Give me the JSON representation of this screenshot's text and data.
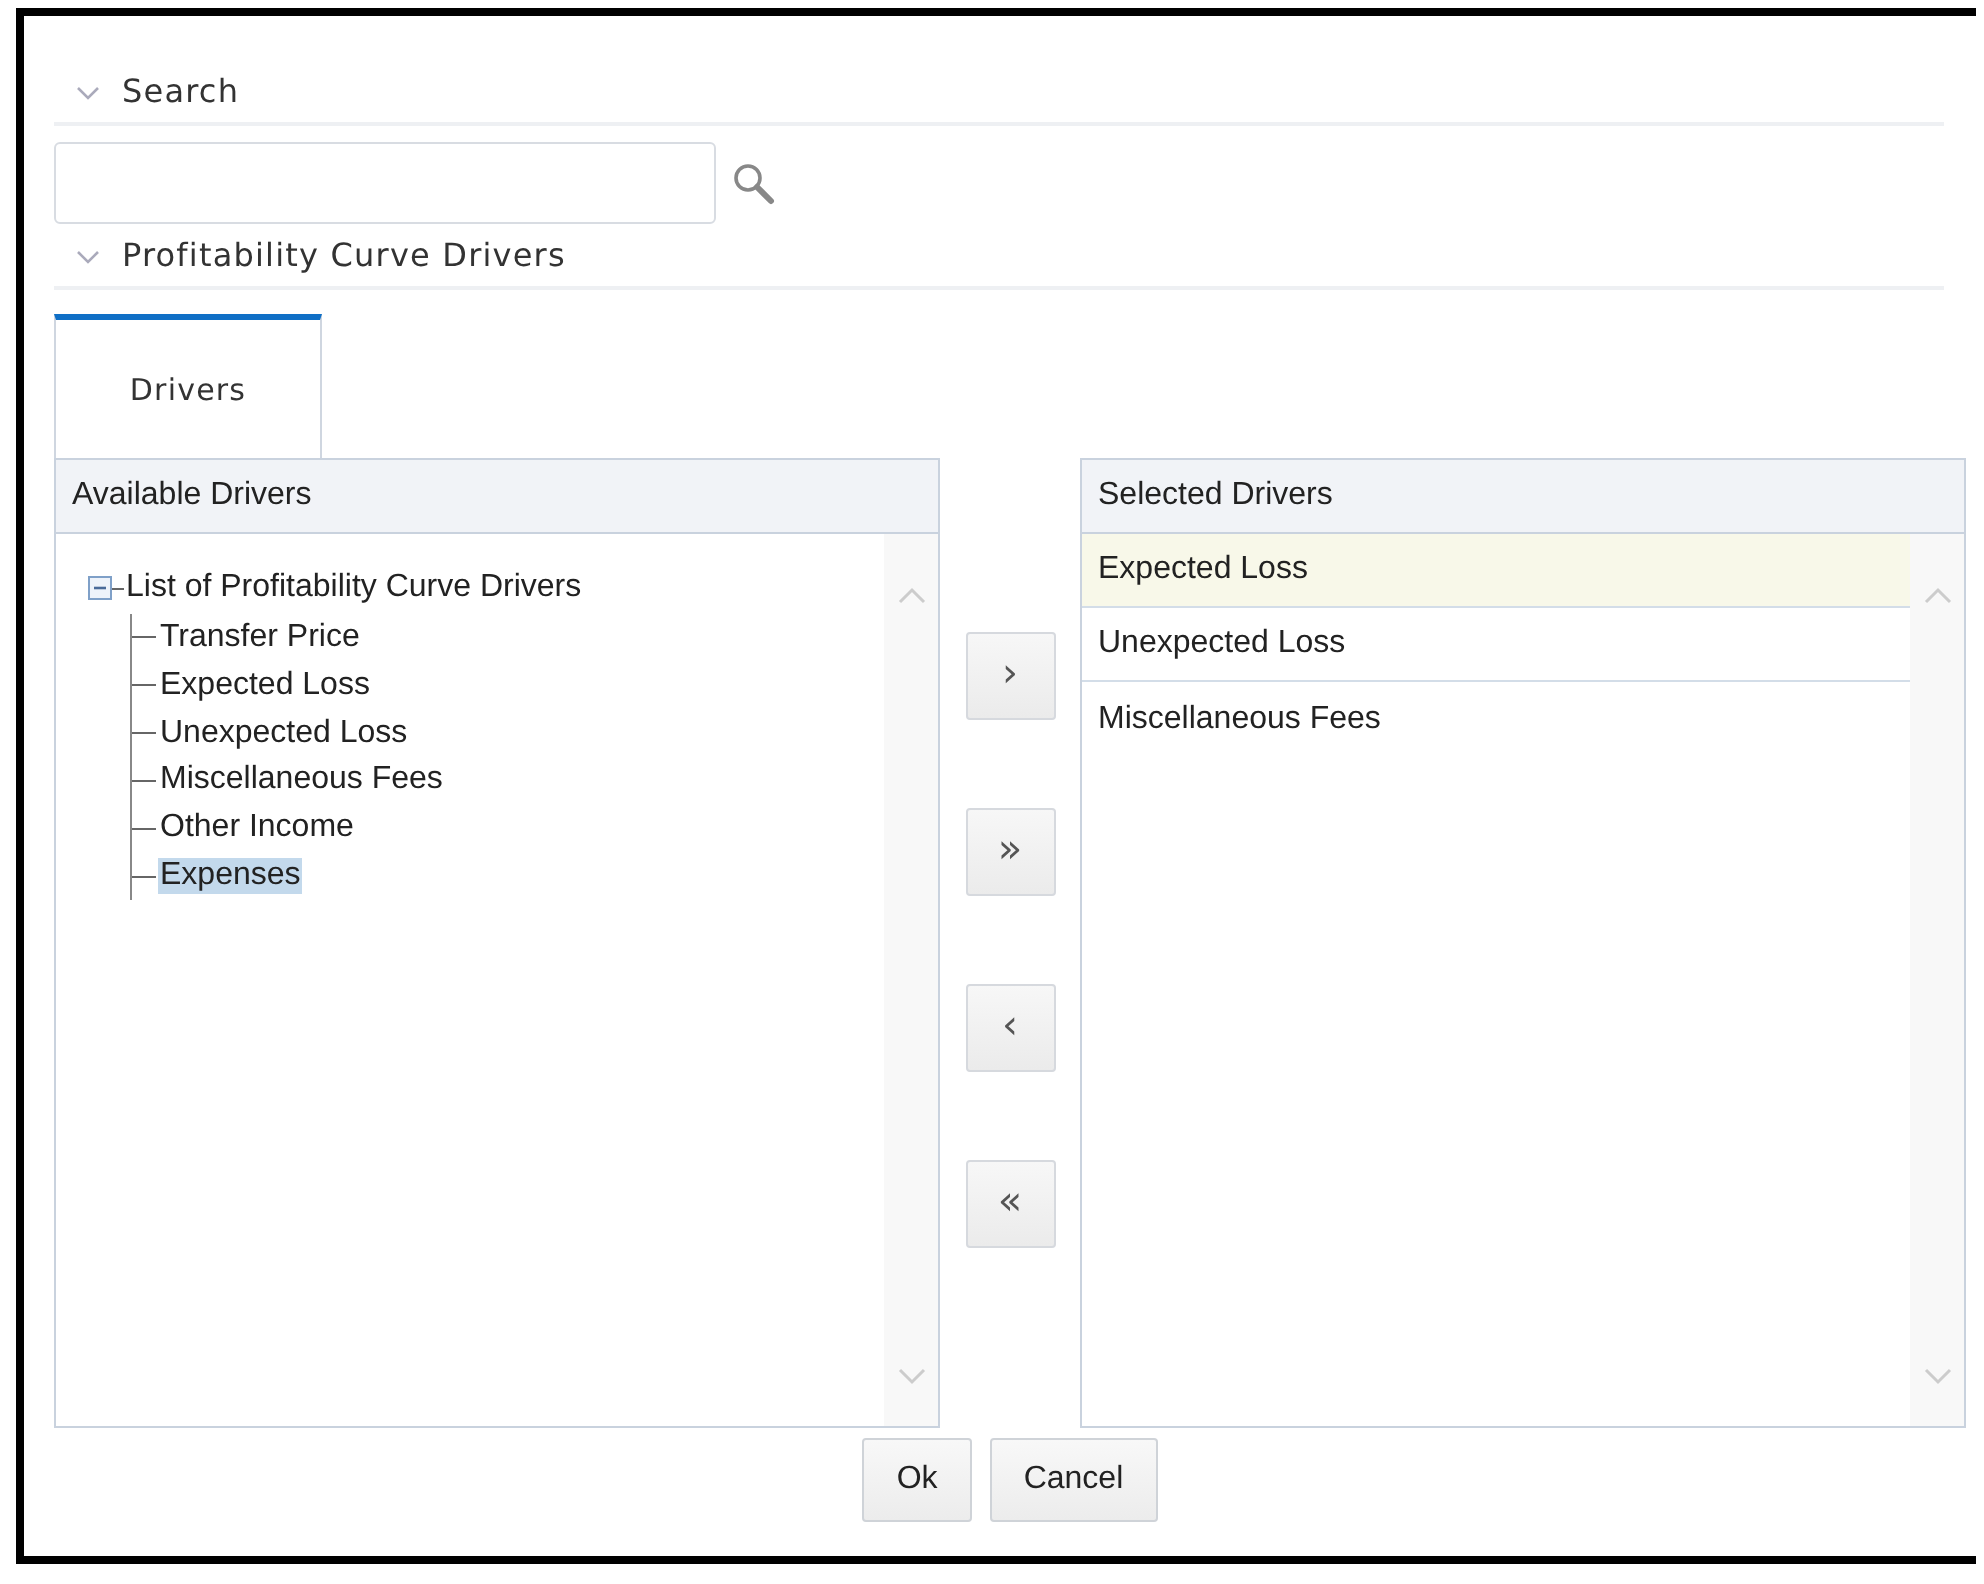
{
  "search_section": {
    "title": "Search",
    "expanded": true
  },
  "drivers_section": {
    "title": "Profitability Curve Drivers",
    "expanded": true
  },
  "tabs": [
    {
      "label": "Drivers",
      "selected": true
    }
  ],
  "available": {
    "header": "Available Drivers",
    "tree": {
      "label": "List of Profitability Curve Drivers",
      "expanded": true,
      "selected": false,
      "children": [
        {
          "label": "Transfer Price",
          "selected": false
        },
        {
          "label": "Expected Loss",
          "selected": false
        },
        {
          "label": "Unexpected Loss",
          "selected": false
        },
        {
          "label": "Miscellaneous Fees",
          "selected": false
        },
        {
          "label": "Other Income",
          "selected": false
        },
        {
          "label": "Expenses",
          "selected": true
        }
      ]
    }
  },
  "move_buttons": [
    "›",
    "»",
    "‹",
    "«"
  ],
  "selected": {
    "header": "Selected Drivers",
    "items": [
      {
        "label": "Expected Loss",
        "selected": true
      },
      {
        "label": "Unexpected Loss",
        "selected": false
      },
      {
        "label": "Miscellaneous Fees",
        "selected": false
      }
    ]
  },
  "buttons": [
    "Ok",
    "Cancel"
  ]
}
